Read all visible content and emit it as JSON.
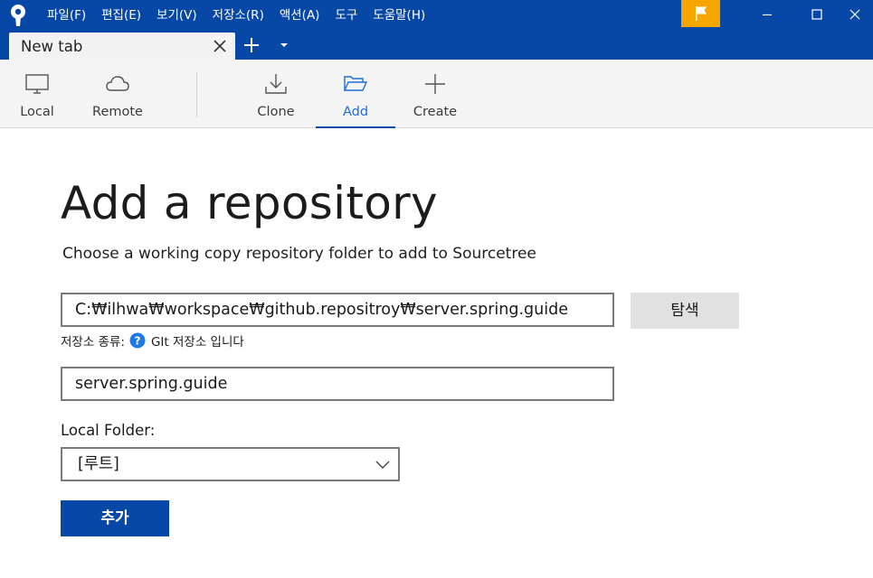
{
  "menu": {
    "items": [
      "파일(F)",
      "편집(E)",
      "보기(V)",
      "저장소(R)",
      "액션(A)",
      "도구",
      "도움말(H)"
    ]
  },
  "tab": {
    "label": "New tab"
  },
  "toolbar": {
    "local_label": "Local",
    "remote_label": "Remote",
    "clone_label": "Clone",
    "add_label": "Add",
    "create_label": "Create",
    "active": "Add"
  },
  "main": {
    "title": "Add a repository",
    "subtitle": "Choose a working copy repository folder to add to Sourcetree",
    "path_value": "C:₩ilhwa₩workspace₩github.repositroy₩server.spring.guide",
    "browse_label": "탐색",
    "repo_type_prefix": "저장소 종류:",
    "repo_type_value": "GIt 저장소 입니다",
    "name_value": "server.spring.guide",
    "local_folder_label": "Local Folder:",
    "local_folder_selected": "[루트]",
    "add_button_label": "추가"
  },
  "colors": {
    "brand_blue": "#0747a6",
    "flag_orange": "#f7a600",
    "active_tab_blue": "#1f6fd6"
  },
  "icons": [
    "sourcetree-logo-icon",
    "flag-icon",
    "minimize-icon",
    "maximize-icon",
    "close-icon",
    "add-tab-icon",
    "chevron-down-icon",
    "monitor-icon",
    "cloud-icon",
    "download-icon",
    "folder-open-icon",
    "plus-icon",
    "help-icon"
  ]
}
